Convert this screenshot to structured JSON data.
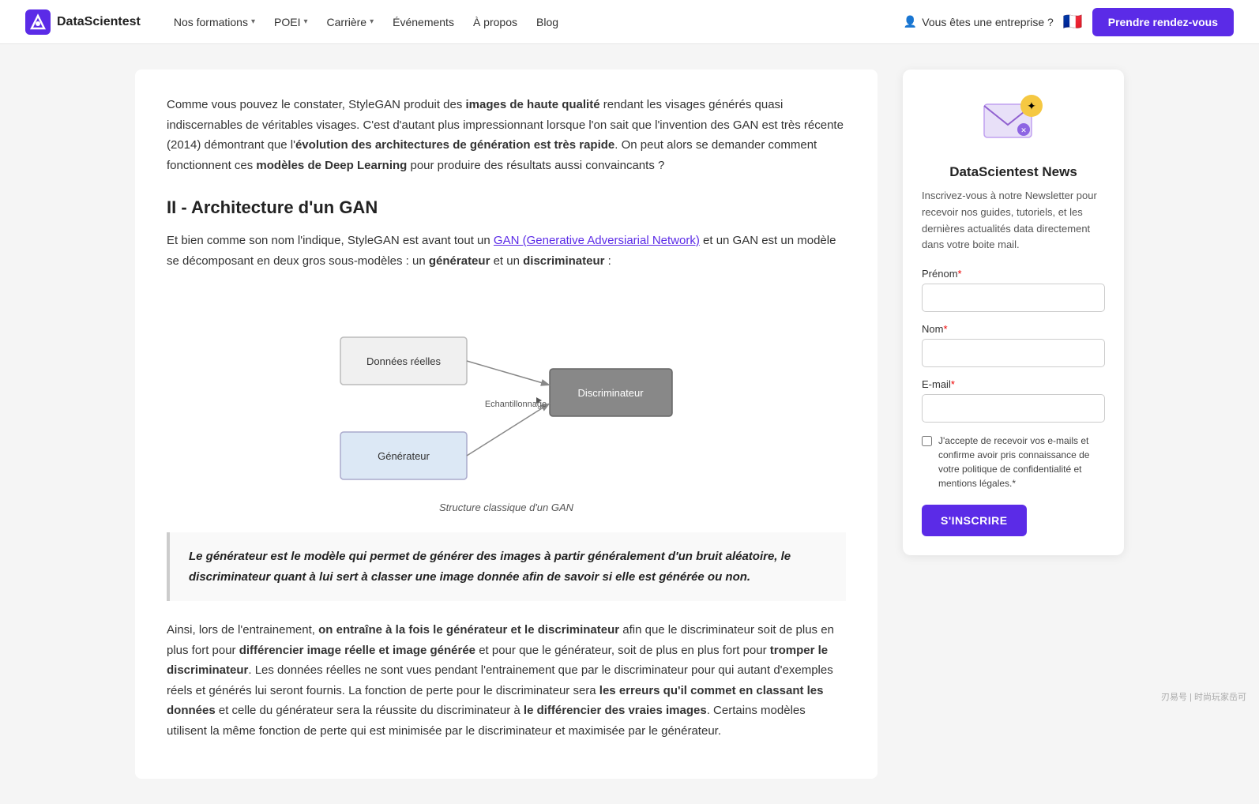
{
  "nav": {
    "logo_text": "DataScientest",
    "links": [
      {
        "label": "Nos formations",
        "has_caret": true
      },
      {
        "label": "POEI",
        "has_caret": true
      },
      {
        "label": "Carrière",
        "has_caret": true
      },
      {
        "label": "Événements",
        "has_caret": false
      },
      {
        "label": "À propos",
        "has_caret": false
      },
      {
        "label": "Blog",
        "has_caret": false
      }
    ],
    "enterprise_label": "Vous êtes une entreprise ?",
    "cta_label": "Prendre rendez-vous"
  },
  "article": {
    "intro_para": "Comme vous pouvez le constater, StyleGAN produit des ",
    "intro_bold1": "images de haute qualité",
    "intro_cont1": " rendant les visages générés quasi indiscernables de véritables visages. C'est d'autant plus impressionnant lorsque l'on sait que l'invention des GAN est très récente (2014) démontrant que l'",
    "intro_bold2": "évolution des architectures de génération est très rapide",
    "intro_cont2": ". On peut alors se demander comment fonctionnent ces ",
    "intro_bold3": "modèles de Deep Learning",
    "intro_cont3": " pour produire des résultats aussi convaincants ?",
    "section_heading": "II - Architecture d'un GAN",
    "section_para1_pre": "Et bien comme son nom l'indique, StyleGAN est avant tout un ",
    "section_link": "GAN (Generative Adversiarial Network)",
    "section_para1_post": " et un GAN est un modèle se décomposant en deux gros sous-modèles : un ",
    "section_bold4": "générateur",
    "section_cont4": " et un ",
    "section_bold5": "discriminateur",
    "section_cont5": " :",
    "diagram_caption": "Structure classique d'un GAN",
    "blockquote": "Le générateur est le modèle qui permet de générer des images à partir généralement d'un bruit aléatoire, le discriminateur quant à lui sert à classer une image donnée afin de savoir si elle est générée ou non.",
    "body_para1_pre": "Ainsi, lors de l'entrainement, ",
    "body_bold1": "on entraîne à la fois le générateur et le discriminateur",
    "body_cont1": " afin que le discriminateur soit de plus en plus fort pour ",
    "body_bold2": "différencier image réelle et image générée",
    "body_cont2": " et pour que le générateur, soit de plus en plus fort pour ",
    "body_bold3": "tromper le discriminateur",
    "body_cont3": ". Les données réelles ne sont vues pendant l'entrainement que par le discriminateur pour qui autant d'exemples réels et générés lui seront fournis. La fonction de perte pour le discriminateur sera ",
    "body_bold4": "les erreurs qu'il commet en classant les données",
    "body_cont4": " et celle du générateur sera la réussite du discriminateur à ",
    "body_bold5": "le différencier des vraies images",
    "body_cont5": ". Certains modèles utilisent la même fonction de perte qui est minimisée par le discriminateur et maximisée par le générateur.",
    "diagram_labels": {
      "donnees_reelles": "Données réelles",
      "generateur": "Générateur",
      "echantillonnage": "Echantillonnage",
      "discriminateur": "Discriminateur"
    }
  },
  "sidebar": {
    "title": "DataScientest News",
    "description": "Inscrivez-vous à notre Newsletter pour recevoir nos guides, tutoriels, et les dernières actualités data directement dans votre boite mail.",
    "prenom_label": "Prénom",
    "nom_label": "Nom",
    "email_label": "E-mail",
    "checkbox_text": "J'accepte de recevoir vos e-mails et confirme avoir pris connaissance de votre politique de confidentialité et mentions légales.",
    "submit_label": "S'INSCRIRE"
  },
  "watermark": "刃易号 | 时尚玩家岳可"
}
